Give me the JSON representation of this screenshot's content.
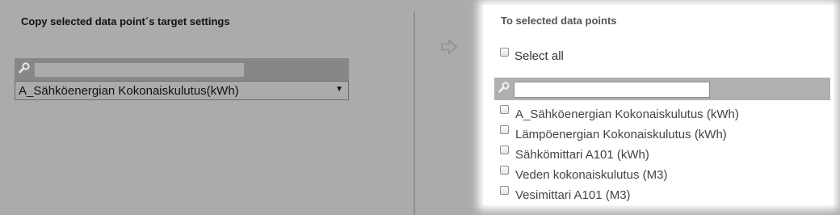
{
  "left": {
    "title": "Copy selected data point´s target settings",
    "search_value": "",
    "selected_data_point": "A_Sähköenergian Kokonaiskulutus(kWh)",
    "select_caret": "▼"
  },
  "right": {
    "title": "To selected data points",
    "select_all_label": "Select all",
    "select_all_checked": false,
    "search_value": "",
    "items": [
      {
        "label": "A_Sähköenergian Kokonaiskulutus (kWh)",
        "checked": false
      },
      {
        "label": "Lämpöenergian Kokonaiskulutus (kWh)",
        "checked": false
      },
      {
        "label": "Sähkömittari A101 (kWh)",
        "checked": false
      },
      {
        "label": "Veden kokonaiskulutus (M3)",
        "checked": false
      },
      {
        "label": "Vesimittari A101 (M3)",
        "checked": false
      }
    ]
  },
  "icons": {
    "left_search": "search-icon",
    "right_search": "search-icon",
    "arrow": "arrow-right-icon"
  },
  "colors": {
    "background": "#ababab",
    "search_bar": "#878787",
    "panel": "#ffffff"
  }
}
